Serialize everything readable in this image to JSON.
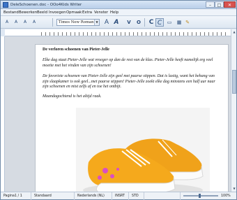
{
  "window": {
    "title": "DeleSchoenen.doc - OOo4Kids Writer",
    "min_symbol": "–",
    "max_symbol": "□",
    "close_symbol": "✕"
  },
  "menu": {
    "items": [
      "Bestand",
      "Bewerken",
      "Beeld",
      "Invoegen",
      "Opmaak",
      "Extra",
      "Venster",
      "Help"
    ]
  },
  "toolbar": {
    "font_name": "Times New Roman",
    "font_drop_symbol": "▼",
    "glyphs": {
      "a1": "A",
      "a2": "A",
      "a3": "A",
      "a4": "A",
      "font_size": "A",
      "bold_italic": "A",
      "underline": "V",
      "ring": "O",
      "c": "C",
      "c2": "C",
      "box": "▭",
      "table": "▦",
      "pen": "✎"
    }
  },
  "document": {
    "heading": "De verloren schoenen van Pieter-Jelle",
    "para1": "Elke dag staat Pieter-Jelle wat vroeger op dan de rest van de klas. Pieter-Jelle heeft namelijk erg veel moeite met het vinden van zijn schoenen!",
    "para2": "De favoriete schoenen van Pieter-Jelle zijn geel met paarse stippen. Dat is lastig, want het behang van zijn slaapkamer is ook geel...met paarse stippen! Pieter-Jelle zoekt elke dag minstens een half uur naar zijn schoenen en mist zelfs af en toe het ontbijt.",
    "para3": "Maandagochtend is het altijd raak."
  },
  "scroll": {
    "up": "▲",
    "down": "▼"
  },
  "status": {
    "page": "Pagina1 / 1",
    "style": "Standaard",
    "language": "Nederlands (NL)",
    "insert": "INSRT",
    "std": "STD",
    "zoom": "100%"
  }
}
